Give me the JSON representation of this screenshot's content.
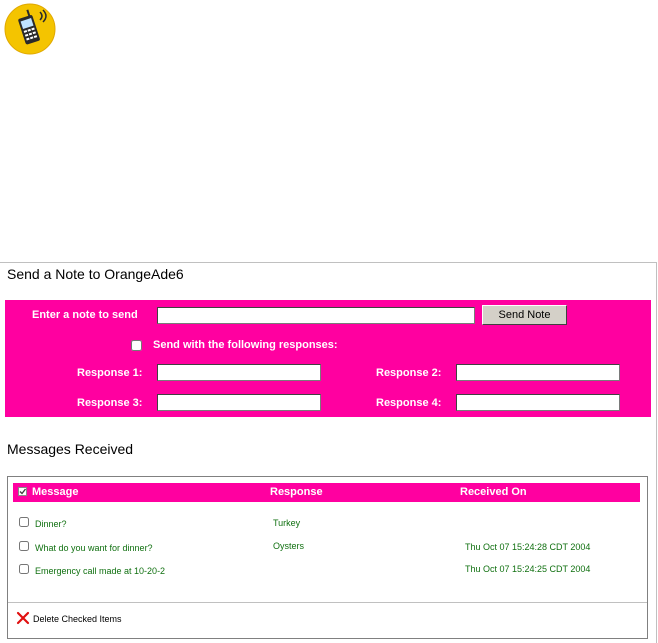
{
  "logo": {
    "icon": "mobile-phone-icon",
    "bg": "#f4c400"
  },
  "send_section": {
    "title": "Send a Note to OrangeAde6",
    "note_label": "Enter a note to send",
    "note_value": "",
    "send_button": "Send Note",
    "responses_checkbox_label": "Send with the following responses:",
    "response1_label": "Response 1:",
    "response2_label": "Response 2:",
    "response3_label": "Response 3:",
    "response4_label": "Response 4:",
    "response1_value": "",
    "response2_value": "",
    "response3_value": "",
    "response4_value": ""
  },
  "messages": {
    "title": "Messages Received",
    "columns": {
      "message": "Message",
      "response": "Response",
      "received_on": "Received On"
    },
    "rows": [
      {
        "message": "Dinner?",
        "response": "Turkey",
        "received_on": ""
      },
      {
        "message": "What do you want for dinner?",
        "response": "Oysters",
        "received_on": "Thu Oct 07 15:24:28 CDT 2004"
      },
      {
        "message": "Emergency call made at 10-20-2",
        "response": "",
        "received_on": "Thu Oct 07 15:24:25 CDT 2004"
      }
    ],
    "delete_label": "Delete Checked Items"
  },
  "colors": {
    "accent": "#ff00a0",
    "row_text": "#107010"
  }
}
